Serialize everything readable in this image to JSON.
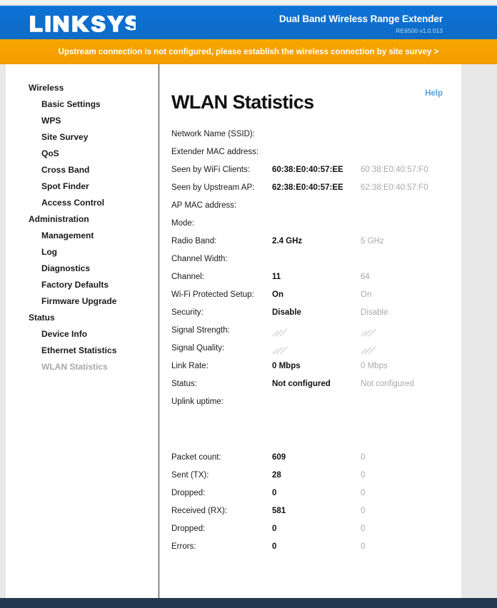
{
  "header": {
    "logo_text": "LINKSYS",
    "logo_tm": "™",
    "product_name": "Dual Band Wireless Range Extender",
    "product_model": "RE6500  v1.0.013"
  },
  "notice": {
    "text": "Upstream connection is not configured, please establish the wireless connection by site survey  >"
  },
  "sidebar": {
    "groups": [
      {
        "title": "Wireless",
        "items": [
          {
            "label": "Basic Settings",
            "active": false
          },
          {
            "label": "WPS",
            "active": false
          },
          {
            "label": "Site Survey",
            "active": false
          },
          {
            "label": "QoS",
            "active": false
          },
          {
            "label": "Cross Band",
            "active": false
          },
          {
            "label": "Spot Finder",
            "active": false
          },
          {
            "label": "Access Control",
            "active": false
          }
        ]
      },
      {
        "title": "Administration",
        "items": [
          {
            "label": "Management",
            "active": false
          },
          {
            "label": "Log",
            "active": false
          },
          {
            "label": "Diagnostics",
            "active": false
          },
          {
            "label": "Factory Defaults",
            "active": false
          },
          {
            "label": "Firmware Upgrade",
            "active": false
          }
        ]
      },
      {
        "title": "Status",
        "items": [
          {
            "label": "Device Info",
            "active": false
          },
          {
            "label": "Ethernet Statistics",
            "active": false
          },
          {
            "label": "WLAN Statistics",
            "active": true
          }
        ]
      }
    ]
  },
  "main": {
    "title": "WLAN Statistics",
    "help_label": "Help",
    "rows": [
      {
        "label": "Network Name (SSID):",
        "v24": "",
        "v5": "",
        "icon": false
      },
      {
        "label": "Extender MAC address:",
        "v24": "",
        "v5": "",
        "icon": false
      },
      {
        "label": "Seen by WiFi Clients:",
        "v24": "60:38:E0:40:57:EE",
        "v5": "60:38:E0:40:57:F0",
        "icon": false
      },
      {
        "label": "Seen by Upstream AP:",
        "v24": "62:38:E0:40:57:EE",
        "v5": "62:38:E0:40:57:F0",
        "icon": false
      },
      {
        "label": "AP MAC address:",
        "v24": "",
        "v5": "",
        "icon": false
      },
      {
        "label": "Mode:",
        "v24": "",
        "v5": "",
        "icon": false
      },
      {
        "label": "Radio Band:",
        "v24": "2.4 GHz",
        "v5": "5 GHz",
        "icon": false
      },
      {
        "label": "Channel Width:",
        "v24": "",
        "v5": "",
        "icon": false
      },
      {
        "label": "Channel:",
        "v24": "11",
        "v5": "64",
        "icon": false
      },
      {
        "label": "Wi-Fi Protected Setup:",
        "v24": "On",
        "v5": "On",
        "icon": false
      },
      {
        "label": "Security:",
        "v24": "Disable",
        "v5": "Disable",
        "icon": false
      },
      {
        "label": "Signal Strength:",
        "v24": "",
        "v5": "",
        "icon": true
      },
      {
        "label": "Signal Quality:",
        "v24": "",
        "v5": "",
        "icon": true
      },
      {
        "label": "Link Rate:",
        "v24": "0 Mbps",
        "v5": "0 Mbps",
        "icon": false
      },
      {
        "label": "Status:",
        "v24": "Not configured",
        "v5": "Not configured",
        "icon": false
      },
      {
        "label": "Uplink uptime:",
        "v24": "",
        "v5": "",
        "icon": false
      }
    ],
    "packet_rows": [
      {
        "label": "Packet count:",
        "v24": "609",
        "v5": "0"
      },
      {
        "label": "Sent (TX):",
        "v24": "28",
        "v5": "0"
      },
      {
        "label": "Dropped:",
        "v24": "0",
        "v5": "0"
      },
      {
        "label": "Received (RX):",
        "v24": "581",
        "v5": "0"
      },
      {
        "label": "Dropped:",
        "v24": "0",
        "v5": "0"
      },
      {
        "label": "Errors:",
        "v24": "0",
        "v5": "0"
      }
    ]
  },
  "colors": {
    "header_blue": "#0f6bc6",
    "notice_orange": "#f6a200",
    "help_blue": "#5a9fd4",
    "footer_navy": "#24394f",
    "muted_grey": "#a9a9a9"
  }
}
